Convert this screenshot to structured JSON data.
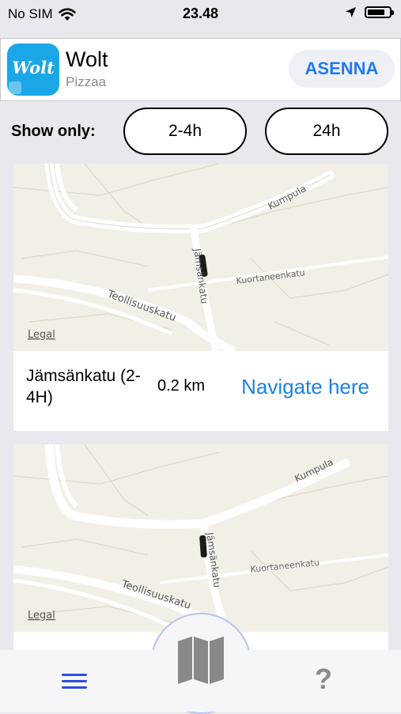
{
  "status_bar": {
    "carrier": "No SIM",
    "time": "23.48",
    "battery_level": 0.8
  },
  "ad": {
    "app_name": "Wolt",
    "subtitle": "Pizzaa",
    "logo_text": "Wolt",
    "install_label": "ASENNA",
    "brand_color": "#1ba6e8"
  },
  "filter": {
    "label": "Show only:",
    "options": [
      "2-4h",
      "24h"
    ]
  },
  "map_labels": {
    "street_jamsankatu": "Jämsänkatu",
    "street_kuortaneenkatu": "Kuortaneenkatu",
    "street_teollisuuskatu": "Teollisuuskatu",
    "street_kumpula": "Kumpula",
    "legal": "Legal"
  },
  "locations": [
    {
      "name": "Jämsänkatu (2-4H)",
      "distance": "0.2 km",
      "action": "Navigate here"
    }
  ],
  "tabbar": {
    "menu_icon": "hamburger-icon",
    "map_icon": "map-icon",
    "help_icon": "question-icon",
    "help_glyph": "?"
  },
  "colors": {
    "accent": "#1a82e2",
    "install_text": "#1e7cf2",
    "tab_icon": "#2b4ee0"
  }
}
